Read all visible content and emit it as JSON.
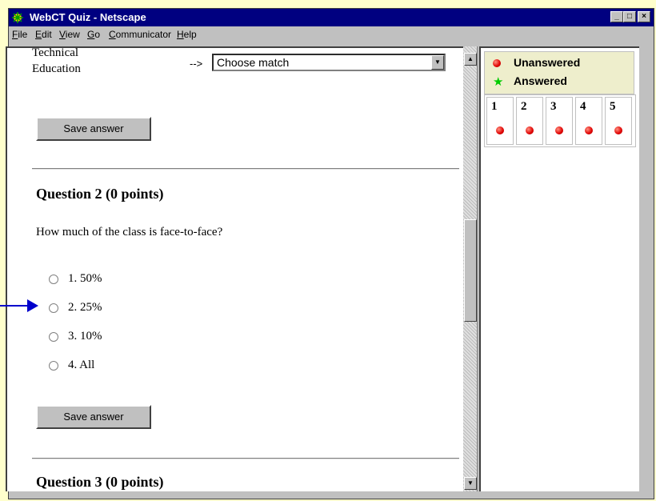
{
  "window": {
    "title": "WebCT Quiz - Netscape"
  },
  "menu": [
    {
      "letter": "F",
      "rest": "ile"
    },
    {
      "letter": "E",
      "rest": "dit"
    },
    {
      "letter": "V",
      "rest": "iew"
    },
    {
      "letter": "G",
      "rest": "o"
    },
    {
      "letter": "C",
      "rest": "ommunicator"
    },
    {
      "letter": "H",
      "rest": "elp"
    }
  ],
  "question1": {
    "match_label_line1": "Technical",
    "match_label_line2": "Education",
    "arrow": "-->",
    "select_value": "Choose match",
    "save_label": "Save answer"
  },
  "question2": {
    "heading": "Question 2  (0 points)",
    "text": "How much of the class is face-to-face?",
    "options": [
      "1.  50%",
      "2.  25%",
      "3.  10%",
      "4.  All"
    ],
    "save_label": "Save answer"
  },
  "question3": {
    "heading": "Question 3  (0 points)"
  },
  "status_panel": {
    "legend_unanswered": "Unanswered",
    "legend_answered": "Answered",
    "questions": [
      "1",
      "2",
      "3",
      "4",
      "5"
    ],
    "unanswered_color": "#e00000",
    "answered_color": "#00cc00"
  },
  "colors": {
    "page_background": "#FFFFCC",
    "title_bar": "#000080",
    "pointer_arrow": "#0000CC"
  }
}
